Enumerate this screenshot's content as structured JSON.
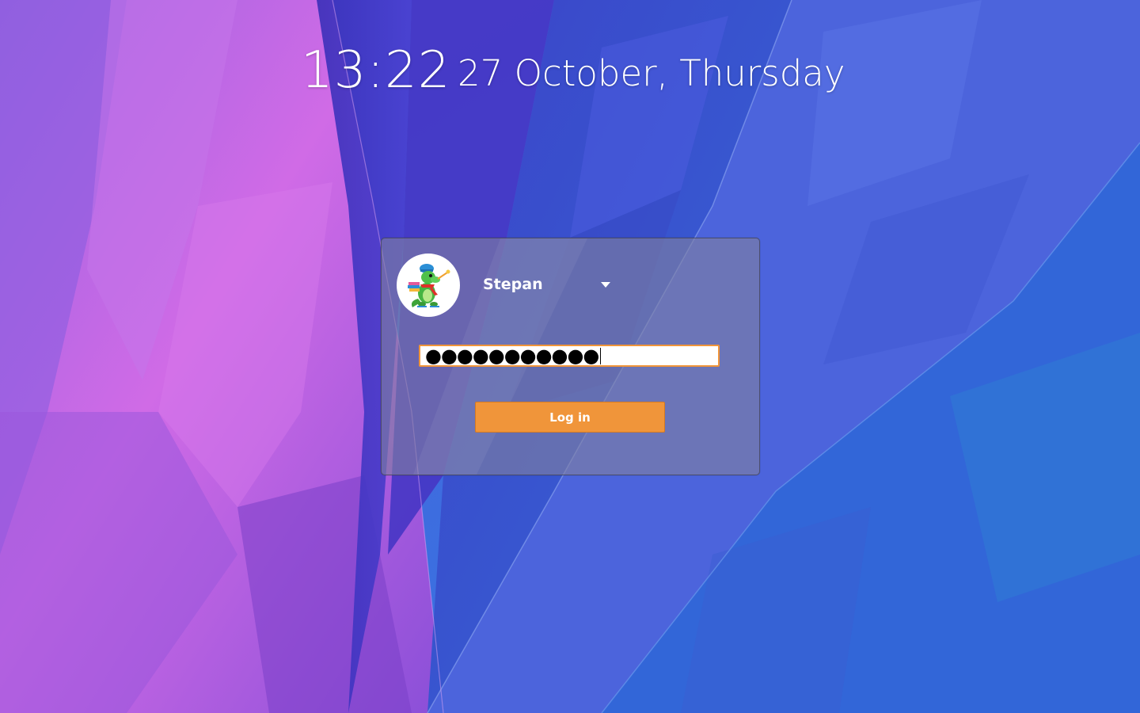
{
  "clock": {
    "time": "13:22",
    "date": "27 October, Thursday"
  },
  "login": {
    "avatar_icon": "konqi-dragon-avatar-icon",
    "user_name": "Stepan",
    "dropdown_icon": "chevron-down-icon",
    "password_masked": "●●●●●●●●●●●",
    "login_button_label": "Log in"
  },
  "colors": {
    "accent": "#f0953a",
    "panel_bg": "rgba(128,128,160,0.62)"
  }
}
